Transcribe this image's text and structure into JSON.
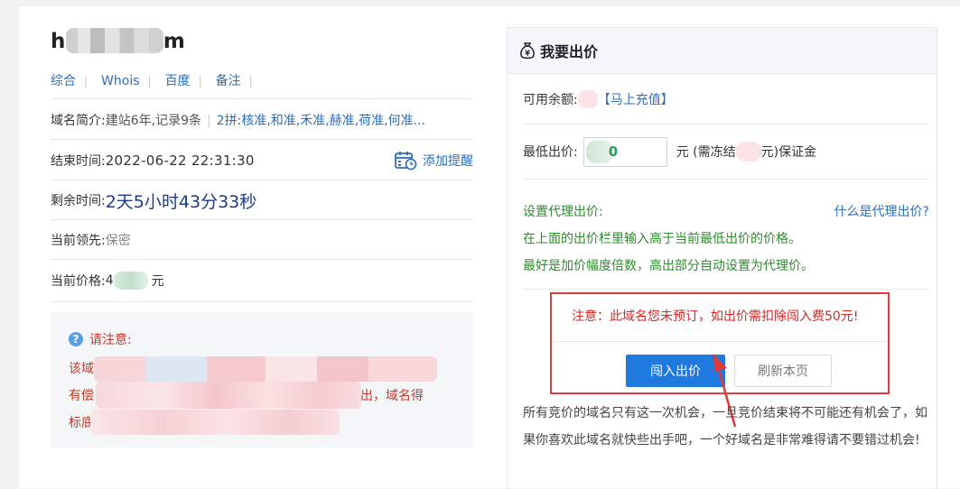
{
  "domain": {
    "prefix": "h",
    "suffix": "m"
  },
  "tabs": [
    "综合",
    "Whois",
    "百度",
    "备注"
  ],
  "intro": {
    "label": "域名简介:",
    "age": "建站6年,记录9条",
    "pinyin": "2拼:核准,和准,禾准,赫准,荷准,何准..."
  },
  "end_time": {
    "label": "结束时间:",
    "value": "2022-06-22 22:31:30",
    "remind": "添加提醒"
  },
  "remaining": {
    "label": "剩余时间:",
    "value": "2天5小时43分33秒"
  },
  "leader": {
    "label": "当前领先:",
    "value": "保密"
  },
  "price": {
    "label": "当前价格:",
    "prefix": "4",
    "unit": "元"
  },
  "notice": {
    "title": "请注意:",
    "line1": "该域",
    "line2_start": "有偿",
    "line2_end": "出，域名得",
    "line3": "标底"
  },
  "bid": {
    "title": "我要出价",
    "balance_label": "可用余额:",
    "recharge": "【马上充值】",
    "min_label": "最低出价:",
    "min_digit": "0",
    "deposit_pre": "元 (需冻结",
    "deposit_post": "元)保证金",
    "proxy_title": "设置代理出价:",
    "proxy_help": "什么是代理出价?",
    "proxy_line1": "在上面的出价栏里输入高于当前最低出价的价格。",
    "proxy_line2": "最好是加价幅度倍数，高出部分自动设置为代理价。",
    "warning": "注意：此域名您未预订，如出价需扣除闯入费50元!",
    "btn_bid": "闯入出价",
    "btn_refresh": "刷新本页",
    "footer": "所有竞价的域名只有这一次机会，一旦竞价结束将不可能还有机会了，如果你喜欢此域名就快些出手吧，一个好域名是非常难得请不要错过机会!"
  },
  "colors": {
    "link": "#2b6fb8",
    "primary": "#1f7ae0",
    "warn": "#d62626",
    "green": "#2e8b2e"
  }
}
